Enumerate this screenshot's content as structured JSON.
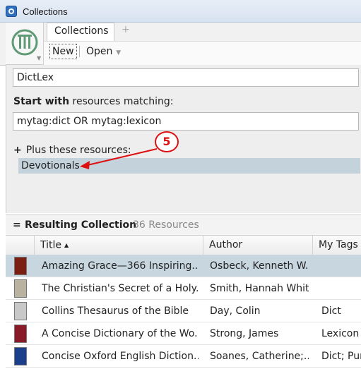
{
  "window": {
    "title": "Collections"
  },
  "tabs": {
    "active_label": "Collections",
    "add_label": "+"
  },
  "toolbar": {
    "new_label": "New",
    "open_label": "Open"
  },
  "editor": {
    "collection_name": "DictLex",
    "start_label_bold": "Start with",
    "start_label_rest": " resources matching:",
    "query": "mytag:dict OR mytag:lexicon",
    "plus_label": "Plus these resources:",
    "plus_symbol": "+",
    "added_resources": [
      "Devotionals"
    ]
  },
  "callout": {
    "number": "5",
    "color": "#dd1111"
  },
  "results": {
    "eq_symbol": "=",
    "title": "Resulting Collection",
    "count": "36 Resources"
  },
  "table": {
    "columns": [
      "Title",
      "Author",
      "My Tags"
    ],
    "rows": [
      {
        "title": "Amazing Grace—366 Inspiring...",
        "author": "Osbeck, Kenneth W.",
        "tags": "",
        "cover_color": "#7a1f12",
        "selected": true
      },
      {
        "title": "The Christian's Secret of a Holy...",
        "author": "Smith, Hannah Whit...",
        "tags": "",
        "cover_color": "#b9b2a0",
        "selected": false
      },
      {
        "title": "Collins Thesaurus of the Bible",
        "author": "Day, Colin",
        "tags": "Dict",
        "cover_color": "#c8c8c8",
        "selected": false
      },
      {
        "title": "A Concise Dictionary of the Wo...",
        "author": "Strong, James",
        "tags": "Lexicon",
        "cover_color": "#8a1a2a",
        "selected": false
      },
      {
        "title": "Concise Oxford English Diction...",
        "author": "Soanes, Catherine;...",
        "tags": "Dict; Pur",
        "cover_color": "#1c3f8c",
        "selected": false
      }
    ]
  },
  "colors": {
    "selection": "#c8d6e0",
    "added_resource_bg": "#c4d2dc",
    "callout_red": "#dd1111"
  }
}
